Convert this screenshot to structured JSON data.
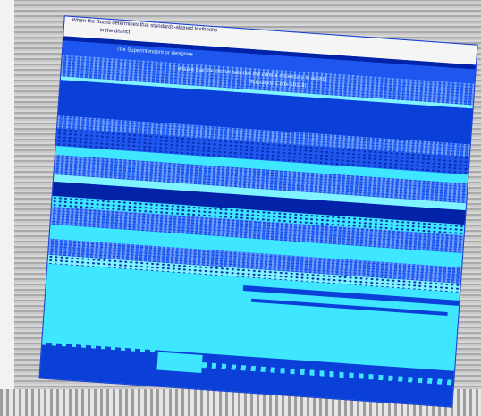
{
  "document": {
    "lines": [
      "When the Board determines that standards-aligned textbooks",
      "in the district",
      "The Superintendent or designee",
      "ensure that the district satisfies the criteria necessary to accept",
      "(Education Code 60119)"
    ]
  }
}
